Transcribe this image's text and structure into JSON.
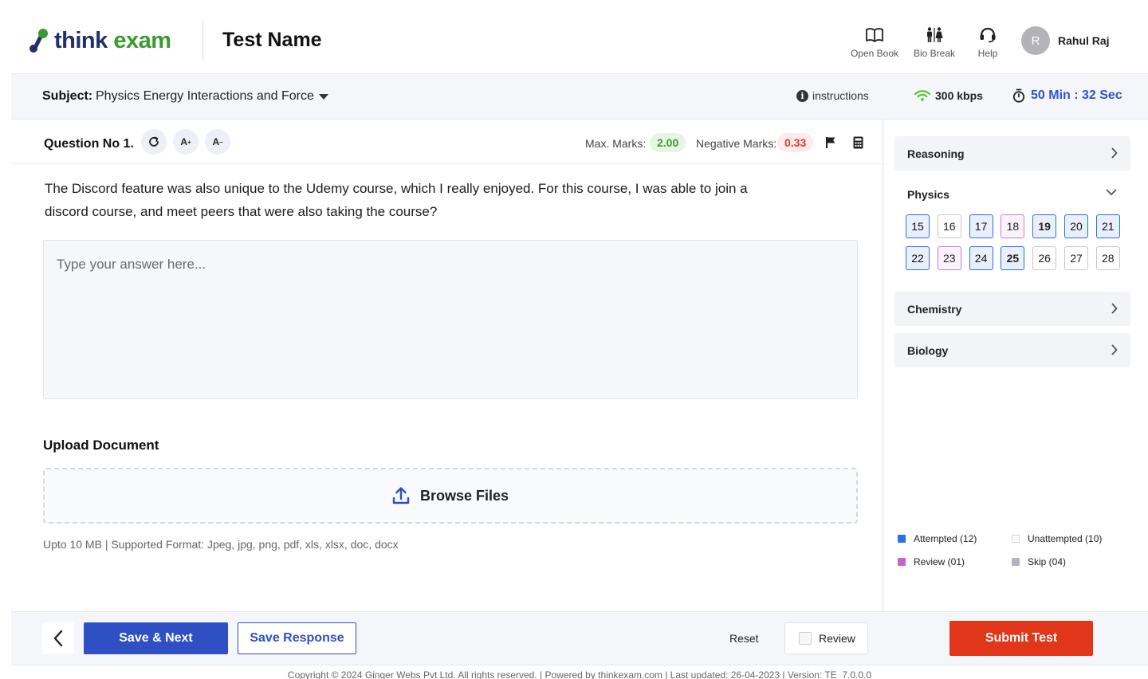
{
  "header": {
    "logo_part1": "think",
    "logo_part2": "exam",
    "test_name": "Test Name",
    "tools": {
      "open_book": "Open Book",
      "bio_break": "Bio Break",
      "help": "Help"
    },
    "user_initial": "R",
    "user_name": "Rahul Raj"
  },
  "subject_bar": {
    "label": "Subject:",
    "value": "Physics Energy Interactions and Force",
    "instructions": "instructions",
    "speed": "300 kbps",
    "timer": "50 Min : 32 Sec"
  },
  "question": {
    "number": "Question No 1.",
    "font_increase": "A",
    "font_decrease": "A",
    "max_marks_label": "Max. Marks:",
    "max_marks": "2.00",
    "negative_marks_label": "Negative Marks:",
    "negative_marks": "0.33",
    "text": "The Discord feature was also unique to the Udemy course, which I really enjoyed. For this course, I was able to join a discord course, and meet peers that were also taking the course?",
    "answer_placeholder": "Type your answer here...",
    "answer_value": ""
  },
  "upload": {
    "title": "Upload Document",
    "button": "Browse Files",
    "note": "Upto 10 MB  |  Supported Format: Jpeg, jpg, png, pdf, xls, xlsx, doc, docx"
  },
  "palette": {
    "sections": {
      "reasoning": "Reasoning",
      "physics": "Physics",
      "chemistry": "Chemistry",
      "biology": "Biology"
    },
    "physics_questions": [
      {
        "n": "15",
        "status": "attempted"
      },
      {
        "n": "16",
        "status": "unattempted"
      },
      {
        "n": "17",
        "status": "attempted"
      },
      {
        "n": "18",
        "status": "review"
      },
      {
        "n": "19",
        "status": "attempted-current"
      },
      {
        "n": "20",
        "status": "attempted"
      },
      {
        "n": "21",
        "status": "attempted"
      },
      {
        "n": "22",
        "status": "attempted"
      },
      {
        "n": "23",
        "status": "review"
      },
      {
        "n": "24",
        "status": "attempted"
      },
      {
        "n": "25",
        "status": "attempted-current"
      },
      {
        "n": "26",
        "status": "unattempted"
      },
      {
        "n": "27",
        "status": "unattempted"
      },
      {
        "n": "28",
        "status": "unattempted"
      }
    ],
    "legend": {
      "attempted": "Attempted (12)",
      "unattempted": "Unattempted (10)",
      "review": "Review (01)",
      "skip": "Skip (04)"
    },
    "colors": {
      "attempted": "#2a6fe3",
      "unattempted": "#ffffff",
      "review": "#c466c9",
      "skip": "#b3b5be"
    }
  },
  "footer_bar": {
    "save_next": "Save & Next",
    "save_response": "Save Response",
    "reset": "Reset",
    "review": "Review",
    "submit": "Submit Test"
  },
  "footer": {
    "copyright": "Copyright © 2024 Ginger Webs Pvt Ltd. All rights reserved.  |  Powered by thinkexam.com  |  Last updated: 26-04-2023  |  Version: TE_7.0.0.0"
  },
  "colors": {
    "primary": "#2f4fc4",
    "submit": "#e2361b",
    "brand_green": "#3a9a2e",
    "brand_navy": "#243069",
    "timer": "#2f55cf"
  },
  "icons": {
    "open_book": "open-book-icon",
    "bio_break": "bio-break-icon",
    "help": "headset-icon",
    "info": "info-icon",
    "wifi": "wifi-icon",
    "timer": "stopwatch-icon",
    "refresh": "refresh-icon",
    "flag": "flag-icon",
    "calculator": "calculator-icon",
    "upload": "upload-icon",
    "back": "chevron-left-icon"
  }
}
